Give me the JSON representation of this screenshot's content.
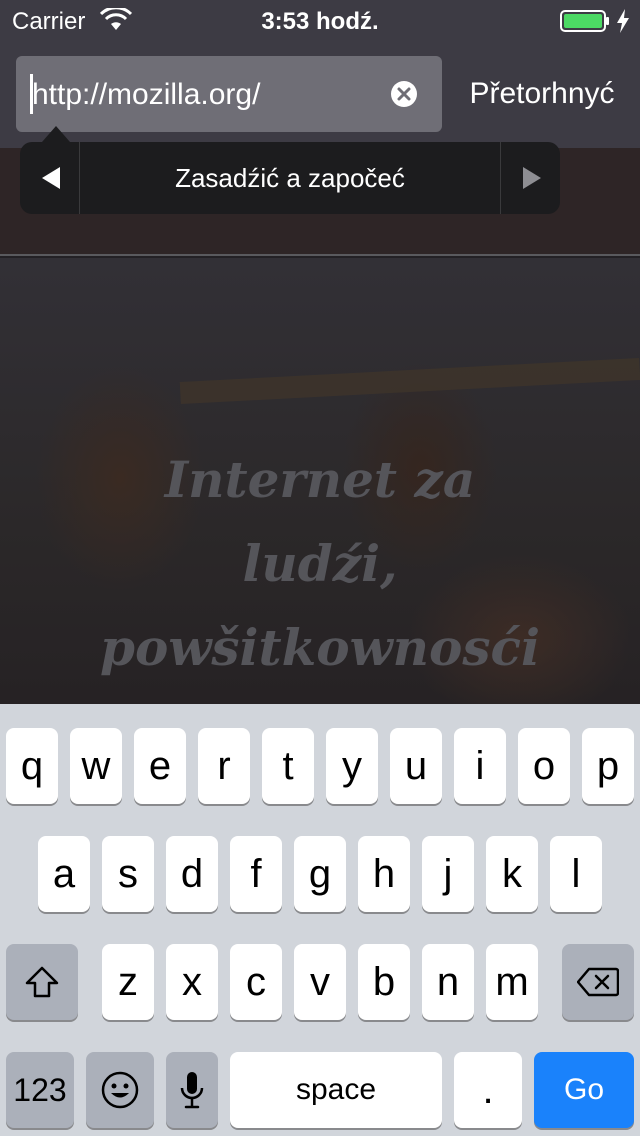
{
  "status_bar": {
    "carrier": "Carrier",
    "time": "3:53 hodź."
  },
  "toolbar": {
    "url": "http://mozilla.org/",
    "cancel_label": "Přetorhnyć"
  },
  "callout": {
    "label": "Zasadźić a započeć"
  },
  "page": {
    "headline_lines": [
      "Internet za",
      "ludźi,",
      "powšitkownosći"
    ]
  },
  "keyboard": {
    "row1": [
      "q",
      "w",
      "e",
      "r",
      "t",
      "y",
      "u",
      "i",
      "o",
      "p"
    ],
    "row2": [
      "a",
      "s",
      "d",
      "f",
      "g",
      "h",
      "j",
      "k",
      "l"
    ],
    "row3": [
      "z",
      "x",
      "c",
      "v",
      "b",
      "n",
      "m"
    ],
    "numbers_label": "123",
    "space_label": "space",
    "period_label": ".",
    "go_label": "Go"
  },
  "colors": {
    "accent": "#1a82fb",
    "battery": "#4cd964"
  }
}
